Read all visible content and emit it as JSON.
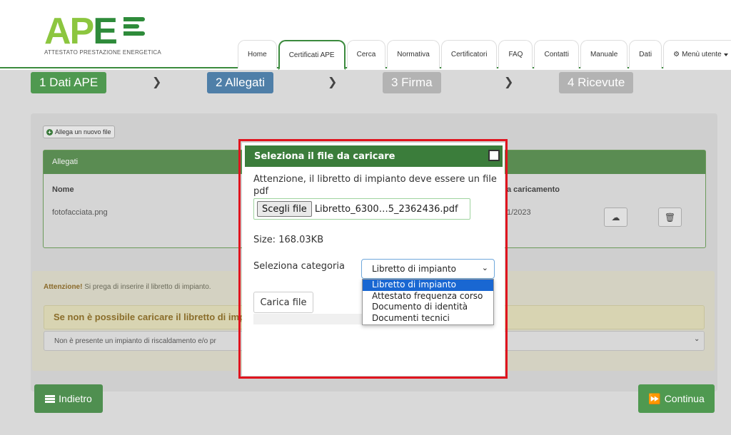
{
  "logo": {
    "text_main": "AP",
    "text_e": "E",
    "subtitle": "ATTESTATO PRESTAZIONE ENERGETICA"
  },
  "nav": {
    "tabs": [
      "Home",
      "Certificati APE",
      "Cerca",
      "Normativa",
      "Certificatori",
      "FAQ",
      "Contatti",
      "Manuale",
      "Dati",
      "Menù utente"
    ],
    "active_index": 1
  },
  "steps": [
    "1 Dati APE",
    "2 Allegati",
    "3 Firma",
    "4 Ricevute"
  ],
  "attach_button": "Allega un nuovo file",
  "table": {
    "title": "Allegati",
    "col_name": "Nome",
    "col_date": "a caricamento",
    "row_file": "fotofacciata.png",
    "row_date": "1/2023"
  },
  "warning": {
    "bold": "Attenzione!",
    "text": "Si prega di inserire il libretto di impianto.",
    "inner_heading": "Se non è possibile caricare il libretto di imp",
    "select_value": "Non è presente un impianto di riscaldamento e/o pr"
  },
  "buttons": {
    "back": "Indietro",
    "next": "Continua"
  },
  "modal": {
    "title": "Seleziona il file da caricare",
    "notice_line1": "Attenzione, il libretto di impianto deve essere un file",
    "notice_line2": "pdf",
    "choose_file": "Scegli file",
    "file_name": "Libretto_6300…5_2362436.pdf",
    "size": "Size: 168.03KB",
    "category_label": "Seleziona categoria",
    "category_selected": "Libretto di impianto",
    "category_options": [
      "Libretto di impianto",
      "Attestato frequenza corso",
      "Documento di identità",
      "Documenti tecnici"
    ],
    "upload_button": "Carica file"
  },
  "colors": {
    "brand_green": "#3b7d3b",
    "light_green": "#8cc63f",
    "highlight_red": "#e0141e",
    "selected_blue": "#1967d2"
  }
}
